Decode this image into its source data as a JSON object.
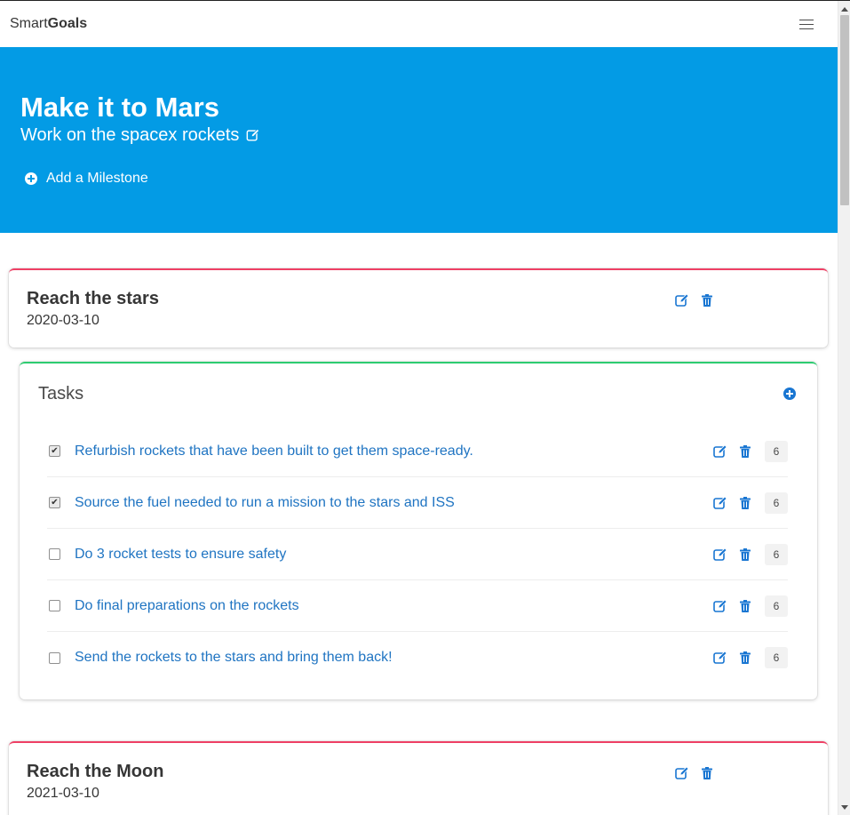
{
  "navbar": {
    "brand_light": "Smart",
    "brand_bold": "Goals",
    "menu_icon": "hamburger-menu-icon"
  },
  "hero": {
    "title": "Make it to Mars",
    "subtitle": "Work on the spacex rockets",
    "add_milestone_label": "Add a Milestone"
  },
  "milestones": [
    {
      "title": "Reach the stars",
      "date": "2020-03-10"
    },
    {
      "title": "Reach the Moon",
      "date": "2021-03-10"
    }
  ],
  "tasks": {
    "heading": "Tasks",
    "items": [
      {
        "label": "Refurbish rockets that have been built to get them space-ready.",
        "checked": true,
        "count": "6"
      },
      {
        "label": "Source the fuel needed to run a mission to the stars and ISS",
        "checked": true,
        "count": "6"
      },
      {
        "label": "Do 3 rocket tests to ensure safety",
        "checked": false,
        "count": "6"
      },
      {
        "label": "Do final preparations on the rockets",
        "checked": false,
        "count": "6"
      },
      {
        "label": "Send the rockets to the stars and bring them back!",
        "checked": false,
        "count": "6"
      }
    ]
  },
  "colors": {
    "hero_bg": "#039be5",
    "link_blue": "#1f74c2",
    "milestone_accent": "#ef4065",
    "tasks_accent": "#2ecc71"
  }
}
